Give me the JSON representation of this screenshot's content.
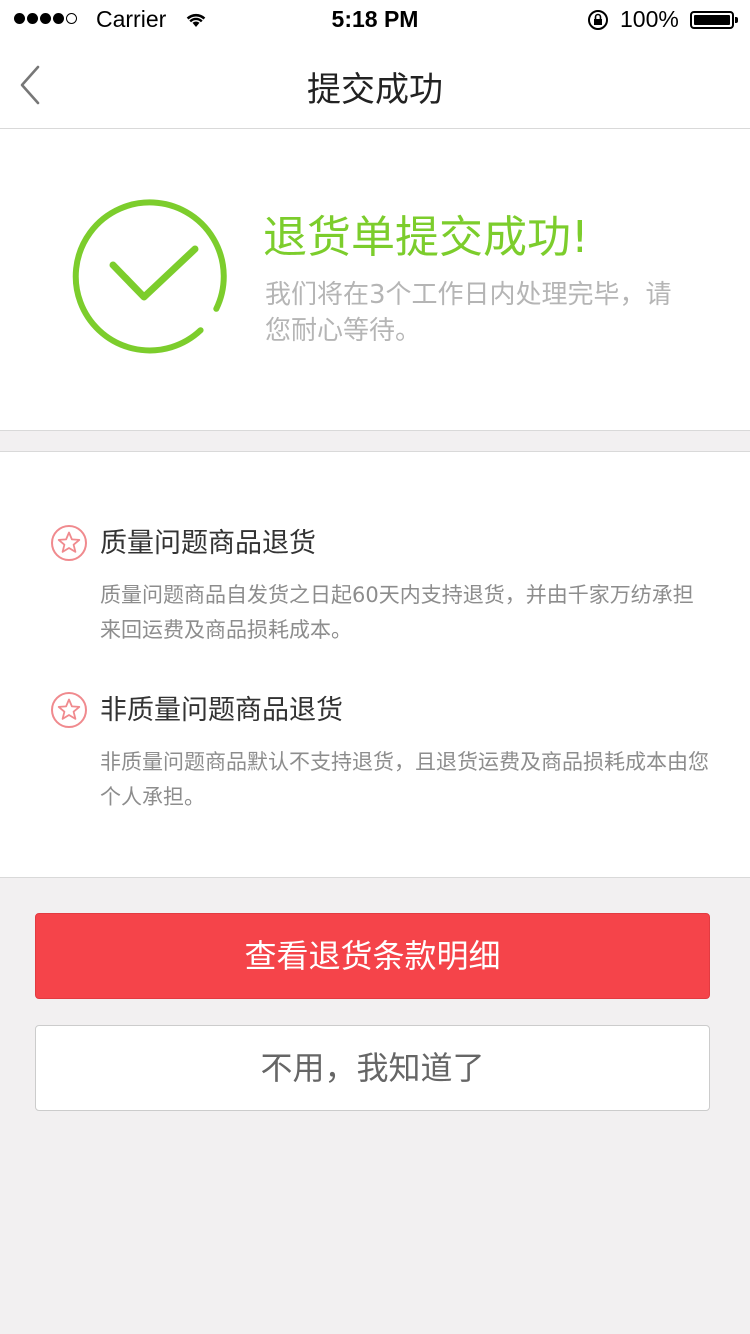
{
  "status_bar": {
    "carrier": "Carrier",
    "time": "5:18 PM",
    "battery": "100%"
  },
  "nav": {
    "title": "提交成功"
  },
  "success": {
    "title": "退货单提交成功!",
    "description": "我们将在3个工作日内处理完毕，请您耐心等待。",
    "color": "#7ccd2c"
  },
  "info": {
    "items": [
      {
        "title": "质量问题商品退货",
        "description": "质量问题商品自发货之日起60天内支持退货，并由千家万纺承担来回运费及商品损耗成本。"
      },
      {
        "title": "非质量问题商品退货",
        "description": "非质量问题商品默认不支持退货，且退货运费及商品损耗成本由您个人承担。"
      }
    ],
    "icon_color": "#f08a8e"
  },
  "actions": {
    "primary_label": "查看退货条款明细",
    "secondary_label": "不用，我知道了",
    "primary_color": "#f5444a"
  }
}
